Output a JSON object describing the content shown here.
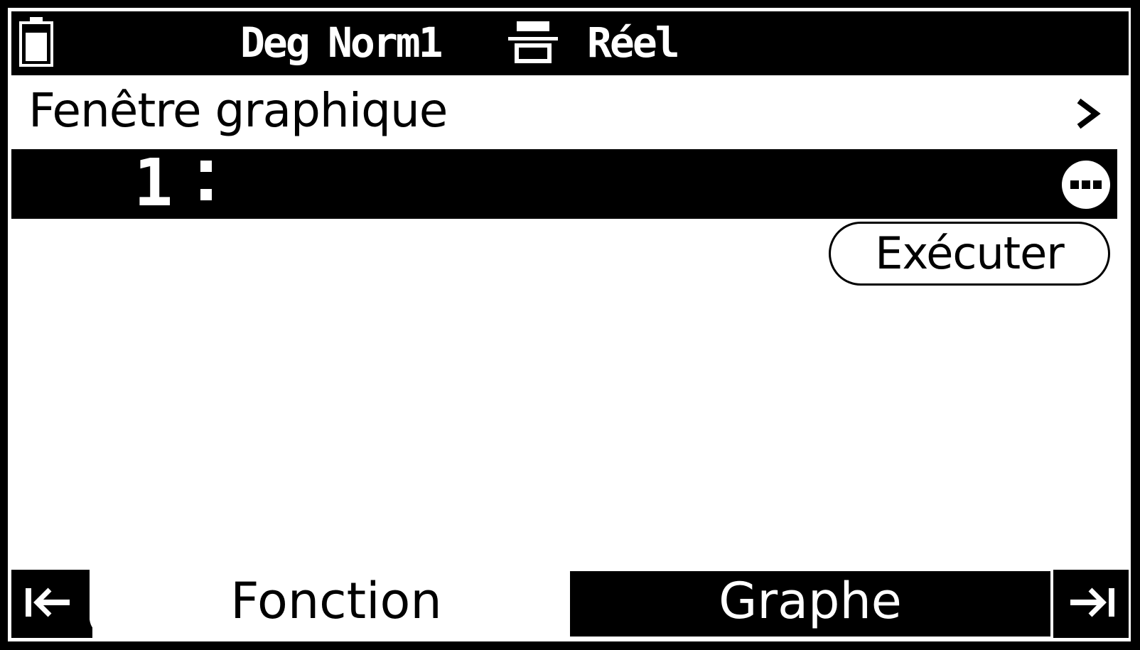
{
  "status_bar": {
    "angle_mode": "Deg",
    "display_mode": "Norm1",
    "number_mode": "Réel",
    "battery_icon": "battery-icon",
    "display_format_icon": "display-format-icon"
  },
  "header": {
    "title": "Fenêtre graphique",
    "chevron_icon": "chevron-right-icon"
  },
  "expression_list": {
    "line_number": "1",
    "more_icon": "more-options-icon"
  },
  "actions": {
    "execute_label": "Exécuter"
  },
  "tabs": {
    "left_nav_icon": "jump-left-icon",
    "items": [
      {
        "label": "Fonction",
        "selected": true
      },
      {
        "label": "Graphe",
        "selected": false
      }
    ],
    "right_nav_icon": "jump-right-icon"
  },
  "colors": {
    "foreground": "#000000",
    "background": "#ffffff"
  }
}
